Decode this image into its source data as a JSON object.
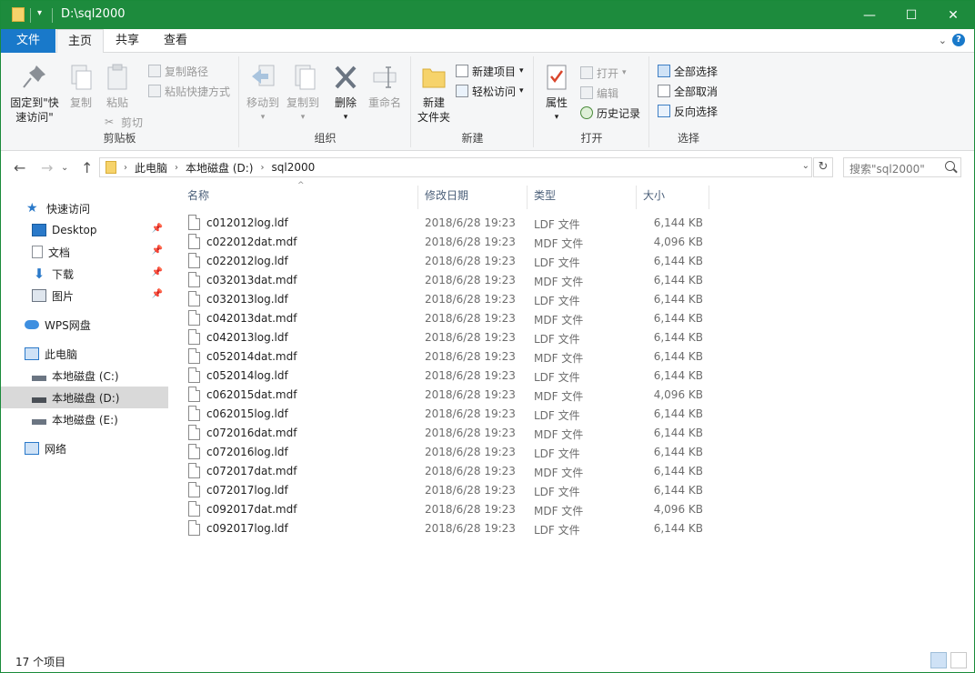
{
  "window": {
    "title": "D:\\sql2000",
    "minimize": "—",
    "maximize": "☐",
    "close": "✕"
  },
  "tabs": {
    "file": "文件",
    "home": "主页",
    "share": "共享",
    "view": "查看"
  },
  "ribbon": {
    "clipboard": {
      "label": "剪贴板",
      "pin": "固定到\"快",
      "pin2": "速访问\"",
      "copy": "复制",
      "paste": "粘贴",
      "cut": "剪切",
      "copy_path": "复制路径",
      "paste_shortcut": "粘贴快捷方式"
    },
    "organize": {
      "label": "组织",
      "move_to": "移动到",
      "copy_to": "复制到",
      "delete": "删除",
      "rename": "重命名"
    },
    "new": {
      "label": "新建",
      "new_folder": "新建",
      "new_folder2": "文件夹",
      "new_item": "新建项目",
      "easy_access": "轻松访问"
    },
    "open": {
      "label": "打开",
      "properties": "属性",
      "open": "打开",
      "edit": "编辑",
      "history": "历史记录"
    },
    "select": {
      "label": "选择",
      "select_all": "全部选择",
      "select_none": "全部取消",
      "invert": "反向选择"
    }
  },
  "address": {
    "crumbs": [
      "此电脑",
      "本地磁盘 (D:)",
      "sql2000"
    ],
    "search_placeholder": "搜索\"sql2000\""
  },
  "nav": {
    "quick_access": "快速访问",
    "desktop": "Desktop",
    "documents": "文档",
    "downloads": "下载",
    "pictures": "图片",
    "wps": "WPS网盘",
    "this_pc": "此电脑",
    "drive_c": "本地磁盘 (C:)",
    "drive_d": "本地磁盘 (D:)",
    "drive_e": "本地磁盘 (E:)",
    "network": "网络"
  },
  "columns": {
    "name": "名称",
    "date": "修改日期",
    "type": "类型",
    "size": "大小"
  },
  "files": [
    {
      "name": "c012012log.ldf",
      "date": "2018/6/28 19:23",
      "type": "LDF 文件",
      "size": "6,144 KB"
    },
    {
      "name": "c022012dat.mdf",
      "date": "2018/6/28 19:23",
      "type": "MDF 文件",
      "size": "4,096 KB"
    },
    {
      "name": "c022012log.ldf",
      "date": "2018/6/28 19:23",
      "type": "LDF 文件",
      "size": "6,144 KB"
    },
    {
      "name": "c032013dat.mdf",
      "date": "2018/6/28 19:23",
      "type": "MDF 文件",
      "size": "6,144 KB"
    },
    {
      "name": "c032013log.ldf",
      "date": "2018/6/28 19:23",
      "type": "LDF 文件",
      "size": "6,144 KB"
    },
    {
      "name": "c042013dat.mdf",
      "date": "2018/6/28 19:23",
      "type": "MDF 文件",
      "size": "6,144 KB"
    },
    {
      "name": "c042013log.ldf",
      "date": "2018/6/28 19:23",
      "type": "LDF 文件",
      "size": "6,144 KB"
    },
    {
      "name": "c052014dat.mdf",
      "date": "2018/6/28 19:23",
      "type": "MDF 文件",
      "size": "6,144 KB"
    },
    {
      "name": "c052014log.ldf",
      "date": "2018/6/28 19:23",
      "type": "LDF 文件",
      "size": "6,144 KB"
    },
    {
      "name": "c062015dat.mdf",
      "date": "2018/6/28 19:23",
      "type": "MDF 文件",
      "size": "4,096 KB"
    },
    {
      "name": "c062015log.ldf",
      "date": "2018/6/28 19:23",
      "type": "LDF 文件",
      "size": "6,144 KB"
    },
    {
      "name": "c072016dat.mdf",
      "date": "2018/6/28 19:23",
      "type": "MDF 文件",
      "size": "6,144 KB"
    },
    {
      "name": "c072016log.ldf",
      "date": "2018/6/28 19:23",
      "type": "LDF 文件",
      "size": "6,144 KB"
    },
    {
      "name": "c072017dat.mdf",
      "date": "2018/6/28 19:23",
      "type": "MDF 文件",
      "size": "6,144 KB"
    },
    {
      "name": "c072017log.ldf",
      "date": "2018/6/28 19:23",
      "type": "LDF 文件",
      "size": "6,144 KB"
    },
    {
      "name": "c092017dat.mdf",
      "date": "2018/6/28 19:23",
      "type": "MDF 文件",
      "size": "4,096 KB"
    },
    {
      "name": "c092017log.ldf",
      "date": "2018/6/28 19:23",
      "type": "LDF 文件",
      "size": "6,144 KB"
    }
  ],
  "status": {
    "count": "17 个项目"
  },
  "colors": {
    "titlebar": "#1d8b3d",
    "file_tab": "#1979ca",
    "selected_nav": "#d9d9d9"
  }
}
